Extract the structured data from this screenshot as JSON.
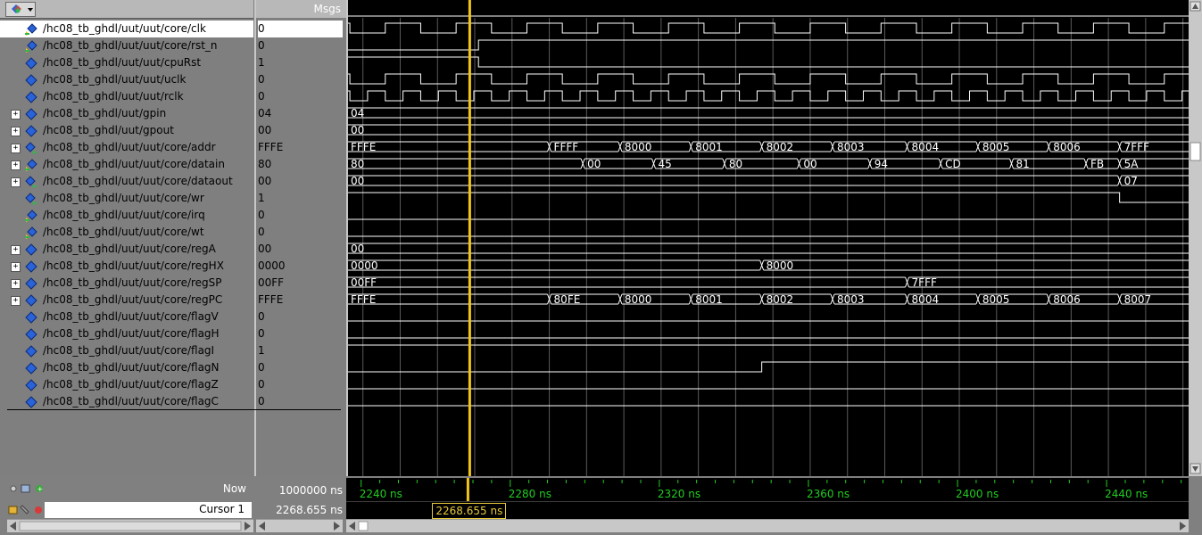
{
  "header": {
    "msgs_label": "Msgs"
  },
  "signals": [
    {
      "name": "/hc08_tb_ghdl/uut/uut/core/clk",
      "value": "0",
      "expandable": false,
      "icon": "signal-in-icon",
      "selected": true
    },
    {
      "name": "/hc08_tb_ghdl/uut/uut/core/rst_n",
      "value": "0",
      "expandable": false,
      "icon": "signal-in-icon"
    },
    {
      "name": "/hc08_tb_ghdl/uut/uut/cpuRst",
      "value": "1",
      "expandable": false,
      "icon": "signal-diamond-icon"
    },
    {
      "name": "/hc08_tb_ghdl/uut/uut/uclk",
      "value": "0",
      "expandable": false,
      "icon": "signal-diamond-icon"
    },
    {
      "name": "/hc08_tb_ghdl/uut/uut/rclk",
      "value": "0",
      "expandable": false,
      "icon": "signal-diamond-icon"
    },
    {
      "name": "/hc08_tb_ghdl/uut/gpin",
      "value": "04",
      "expandable": true,
      "icon": "signal-diamond-icon"
    },
    {
      "name": "/hc08_tb_ghdl/uut/gpout",
      "value": "00",
      "expandable": true,
      "icon": "signal-diamond-icon"
    },
    {
      "name": "/hc08_tb_ghdl/uut/uut/core/addr",
      "value": "FFFE",
      "expandable": true,
      "icon": "signal-out-icon"
    },
    {
      "name": "/hc08_tb_ghdl/uut/uut/core/datain",
      "value": "80",
      "expandable": true,
      "icon": "signal-in-icon"
    },
    {
      "name": "/hc08_tb_ghdl/uut/uut/core/dataout",
      "value": "00",
      "expandable": true,
      "icon": "signal-out-icon"
    },
    {
      "name": "/hc08_tb_ghdl/uut/uut/core/wr",
      "value": "1",
      "expandable": false,
      "icon": "signal-out-icon"
    },
    {
      "name": "/hc08_tb_ghdl/uut/uut/core/irq",
      "value": "0",
      "expandable": false,
      "icon": "signal-in-icon"
    },
    {
      "name": "/hc08_tb_ghdl/uut/uut/core/wt",
      "value": "0",
      "expandable": false,
      "icon": "signal-in-icon"
    },
    {
      "name": "/hc08_tb_ghdl/uut/uut/core/regA",
      "value": "00",
      "expandable": true,
      "icon": "signal-diamond-icon"
    },
    {
      "name": "/hc08_tb_ghdl/uut/uut/core/regHX",
      "value": "0000",
      "expandable": true,
      "icon": "signal-diamond-icon"
    },
    {
      "name": "/hc08_tb_ghdl/uut/uut/core/regSP",
      "value": "00FF",
      "expandable": true,
      "icon": "signal-diamond-icon"
    },
    {
      "name": "/hc08_tb_ghdl/uut/uut/core/regPC",
      "value": "FFFE",
      "expandable": true,
      "icon": "signal-diamond-icon"
    },
    {
      "name": "/hc08_tb_ghdl/uut/uut/core/flagV",
      "value": "0",
      "expandable": false,
      "icon": "signal-diamond-icon"
    },
    {
      "name": "/hc08_tb_ghdl/uut/uut/core/flagH",
      "value": "0",
      "expandable": false,
      "icon": "signal-diamond-icon"
    },
    {
      "name": "/hc08_tb_ghdl/uut/uut/core/flagI",
      "value": "1",
      "expandable": false,
      "icon": "signal-diamond-icon"
    },
    {
      "name": "/hc08_tb_ghdl/uut/uut/core/flagN",
      "value": "0",
      "expandable": false,
      "icon": "signal-diamond-icon"
    },
    {
      "name": "/hc08_tb_ghdl/uut/uut/core/flagZ",
      "value": "0",
      "expandable": false,
      "icon": "signal-diamond-icon"
    },
    {
      "name": "/hc08_tb_ghdl/uut/uut/core/flagC",
      "value": "0",
      "expandable": false,
      "icon": "signal-diamond-icon"
    }
  ],
  "waves": {
    "time_range_ns": [
      2236,
      2462
    ],
    "cursor_ns": 2268.655,
    "clk_period_ns": 19,
    "clk_first_rise_ns": 2246,
    "bus": {
      "gpin": [
        {
          "t": 2236,
          "v": "04"
        }
      ],
      "gpout": [
        {
          "t": 2236,
          "v": "00"
        }
      ],
      "addr": [
        {
          "t": 2236,
          "v": "FFFE"
        },
        {
          "t": 2290,
          "v": "FFFF"
        },
        {
          "t": 2309,
          "v": "8000"
        },
        {
          "t": 2328,
          "v": "8001"
        },
        {
          "t": 2347,
          "v": "8002"
        },
        {
          "t": 2366,
          "v": "8003"
        },
        {
          "t": 2386,
          "v": "8004"
        },
        {
          "t": 2405,
          "v": "8005"
        },
        {
          "t": 2424,
          "v": "8006"
        },
        {
          "t": 2443,
          "v": "7FFF"
        }
      ],
      "datain": [
        {
          "t": 2236,
          "v": "80"
        },
        {
          "t": 2299,
          "v": "00"
        },
        {
          "t": 2318,
          "v": "45"
        },
        {
          "t": 2337,
          "v": "80"
        },
        {
          "t": 2357,
          "v": "00"
        },
        {
          "t": 2376,
          "v": "94"
        },
        {
          "t": 2395,
          "v": "CD"
        },
        {
          "t": 2414,
          "v": "81"
        },
        {
          "t": 2434,
          "v": "FB"
        },
        {
          "t": 2443,
          "v": "5A"
        }
      ],
      "dataout": [
        {
          "t": 2236,
          "v": "00"
        },
        {
          "t": 2443,
          "v": "07"
        }
      ],
      "regA": [
        {
          "t": 2236,
          "v": "00"
        }
      ],
      "regHX": [
        {
          "t": 2236,
          "v": "0000"
        },
        {
          "t": 2347,
          "v": "8000"
        }
      ],
      "regSP": [
        {
          "t": 2236,
          "v": "00FF"
        },
        {
          "t": 2386,
          "v": "7FFF"
        }
      ],
      "regPC": [
        {
          "t": 2236,
          "v": "FFFE"
        },
        {
          "t": 2290,
          "v": "80FE"
        },
        {
          "t": 2309,
          "v": "8000"
        },
        {
          "t": 2328,
          "v": "8001"
        },
        {
          "t": 2347,
          "v": "8002"
        },
        {
          "t": 2366,
          "v": "8003"
        },
        {
          "t": 2386,
          "v": "8004"
        },
        {
          "t": 2405,
          "v": "8005"
        },
        {
          "t": 2424,
          "v": "8006"
        },
        {
          "t": 2443,
          "v": "8007"
        }
      ]
    }
  },
  "time_axis": {
    "ticks": [
      "2240 ns",
      "2280 ns",
      "2320 ns",
      "2360 ns",
      "2400 ns",
      "2440 ns"
    ],
    "tick_values_ns": [
      2240,
      2280,
      2320,
      2360,
      2400,
      2440
    ]
  },
  "footer": {
    "now_label": "Now",
    "now_value": "1000000 ns",
    "cursor_label": "Cursor 1",
    "cursor_value": "2268.655 ns",
    "cursor_tag": "2268.655 ns"
  },
  "colors": {
    "wave_bg": "#000000",
    "wave_line": "#ffffff",
    "grid": "#5a5a5a",
    "cursor": "#f0c419",
    "axis_text": "#22cc22",
    "panel": "#808080"
  }
}
